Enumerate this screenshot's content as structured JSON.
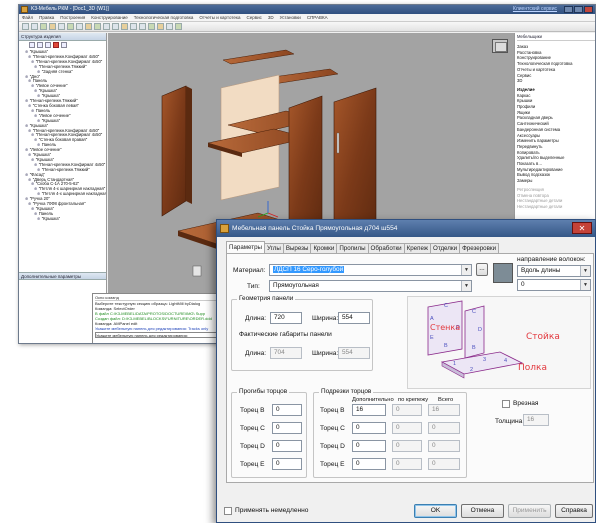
{
  "app": {
    "title": "K3-Мебель РКМ - [Doc1_3D (W1)]",
    "help_link": "Клиентский сервис",
    "menu": [
      "Файл",
      "Правка",
      "Построения",
      "Конструирование",
      "Технологическая подготовка",
      "Отчеты и картотека",
      "Сервис",
      "3D",
      "Установки",
      "СПРАВКА"
    ]
  },
  "tree": {
    "title": "Структура изделия",
    "items": [
      "\"Крышка\"",
      "\"Пенал-крепежн.Конфирмат 4х50\"",
      "\"Пенал-крепежн.Конфирмат 4х50\"",
      "\"Пенал-крепежн.Тяжкий\"",
      "\"Задняя стенка\"",
      "\"Дно\"",
      "Панель",
      "\"Левое сечение\"",
      "\"Крышка\"",
      "\"Крышка\"",
      "\"Пенал-крепежн.Тяжкий\"",
      "\"Стенка боковая левая\"",
      "Панель",
      "\"Левое сечение\"",
      "\"Крышка\"",
      "\"Крышка\"",
      "\"Пенал-крепежн.Конфирмат 4х50\"",
      "\"Пенал-крепежн.Конфирмат 4х50\"",
      "\"Стенка боковая правая\"",
      "Панель",
      "\"Левое сечение\"",
      "\"Крышка\"",
      "\"Крышка\"",
      "\"Пенал-крепежн.Конфирмат 4х50\"",
      "\"Пенал-крепежн.Тяжкий\"",
      "\"Фасад\"",
      "\"Дверь Стандартная\"",
      "\"Скоба С-1А 270-5-62\"",
      "\"Петля 4-х шарнирная накладная\"",
      "\"Петля 4-х шарнирная накладная\"",
      "\"Ручка 20\"",
      "\"Ручка 70Ф8 фронтальная\"",
      "\"Крышка\"",
      "Панель",
      "\"Крышка\""
    ],
    "params_title": "Дополнительные параметры"
  },
  "command": {
    "title": "Окно команд",
    "lines": [
      "Выберите текстурную секцию образца: LightMill byDialog",
      "Команда: SelectOrder",
      "В файл C:\\K3-MEBEL\\DATA\\PROTOS\\DOCTURE\\IMG\\ Supp",
      "Создан файл: D:\\K3-MEBEL\\BLOCKS\\FURNITURE\\ORDER.ddd",
      "Команда: AMPanel edit",
      "Укажите мебельную панель для редактирования: Tracks only",
      "Укажите мебельную панель для редактирования:"
    ]
  },
  "right_panel": {
    "title": "Мебельщики",
    "sections": [
      [
        "Заказ",
        "Расстановка",
        "Конструирование",
        "Технологическая подготовка",
        "Отчеты и картотека",
        "Сервис",
        "3D"
      ],
      [
        "Изделие",
        "Каркас",
        "Крышки",
        "Профили",
        "Ящики",
        "Раскладная дверь",
        "Сантехнический",
        "Бандеронная система",
        "Аксессуары",
        "Изменить параметры",
        "Передвинуть",
        "Копировать",
        "Удалить/по выделенные",
        "Показать в…",
        "Мультиредактирование",
        "Вывод подсказок",
        "Замеры"
      ],
      [
        "Ретроспекция",
        "Отмена повтора",
        "Нестандартные детали",
        "Нестандартные детали"
      ]
    ]
  },
  "dialog": {
    "title": "Мебельная панель Стойка Прямоугольная д704 ш554",
    "tabs": [
      "Параметры",
      "Углы",
      "Вырезы",
      "Кромки",
      "Пропилы",
      "Обработки",
      "Крепеж",
      "Отделки",
      "Фрезеровки"
    ],
    "material_label": "Материал:",
    "material_value": "ЛДСП 16 Серо-голубой",
    "more_button": "...",
    "type_label": "Тип:",
    "type_value": "Прямоугольная",
    "grain_label": "направление волокон:",
    "grain_value": "Вдоль длины",
    "grain_angle": "0",
    "geometry_caption": "Геометрия панели",
    "length_label": "Длина:",
    "length_value": "720",
    "width_label": "Ширина:",
    "width_value": "554",
    "actual_caption": "Фактические габариты панели",
    "actual_length_label": "Длина:",
    "actual_length_value": "704",
    "actual_width_label": "Ширина:",
    "actual_width_value": "554",
    "diagram_labels": {
      "stenka": "Стенка",
      "stoika": "Стойка",
      "polka": "Полка",
      "letters": [
        "A",
        "B",
        "C",
        "D",
        "E",
        "1",
        "2",
        "3",
        "4"
      ]
    },
    "bends_caption": "Прогибы торцов",
    "bends": [
      {
        "label": "Торец B",
        "value": "0"
      },
      {
        "label": "Торец C",
        "value": "0"
      },
      {
        "label": "Торец D",
        "value": "0"
      },
      {
        "label": "Торец E",
        "value": "0"
      }
    ],
    "trims_caption": "Подрезки торцов",
    "trims_headers": [
      "Дополнительно",
      "по крепежу",
      "Всего"
    ],
    "trims": [
      {
        "label": "Торец B",
        "extra": "16",
        "fix": "0",
        "total": "16"
      },
      {
        "label": "Торец C",
        "extra": "0",
        "fix": "0",
        "total": "0"
      },
      {
        "label": "Торец D",
        "extra": "0",
        "fix": "0",
        "total": "0"
      },
      {
        "label": "Торец E",
        "extra": "0",
        "fix": "0",
        "total": "0"
      }
    ],
    "inset_label": "Врезная",
    "thickness_label": "Толщина",
    "thickness_value": "16",
    "apply_now_label": "Применять немедленно",
    "buttons": {
      "ok": "OK",
      "cancel": "Отмена",
      "apply": "Применить",
      "help": "Справка"
    }
  },
  "colors": {
    "accent": "#355787",
    "wood": "#7a3a1e",
    "wood_light": "#a05a30",
    "back_panel": "#f2dcc3",
    "label_red": "#e2393f"
  }
}
